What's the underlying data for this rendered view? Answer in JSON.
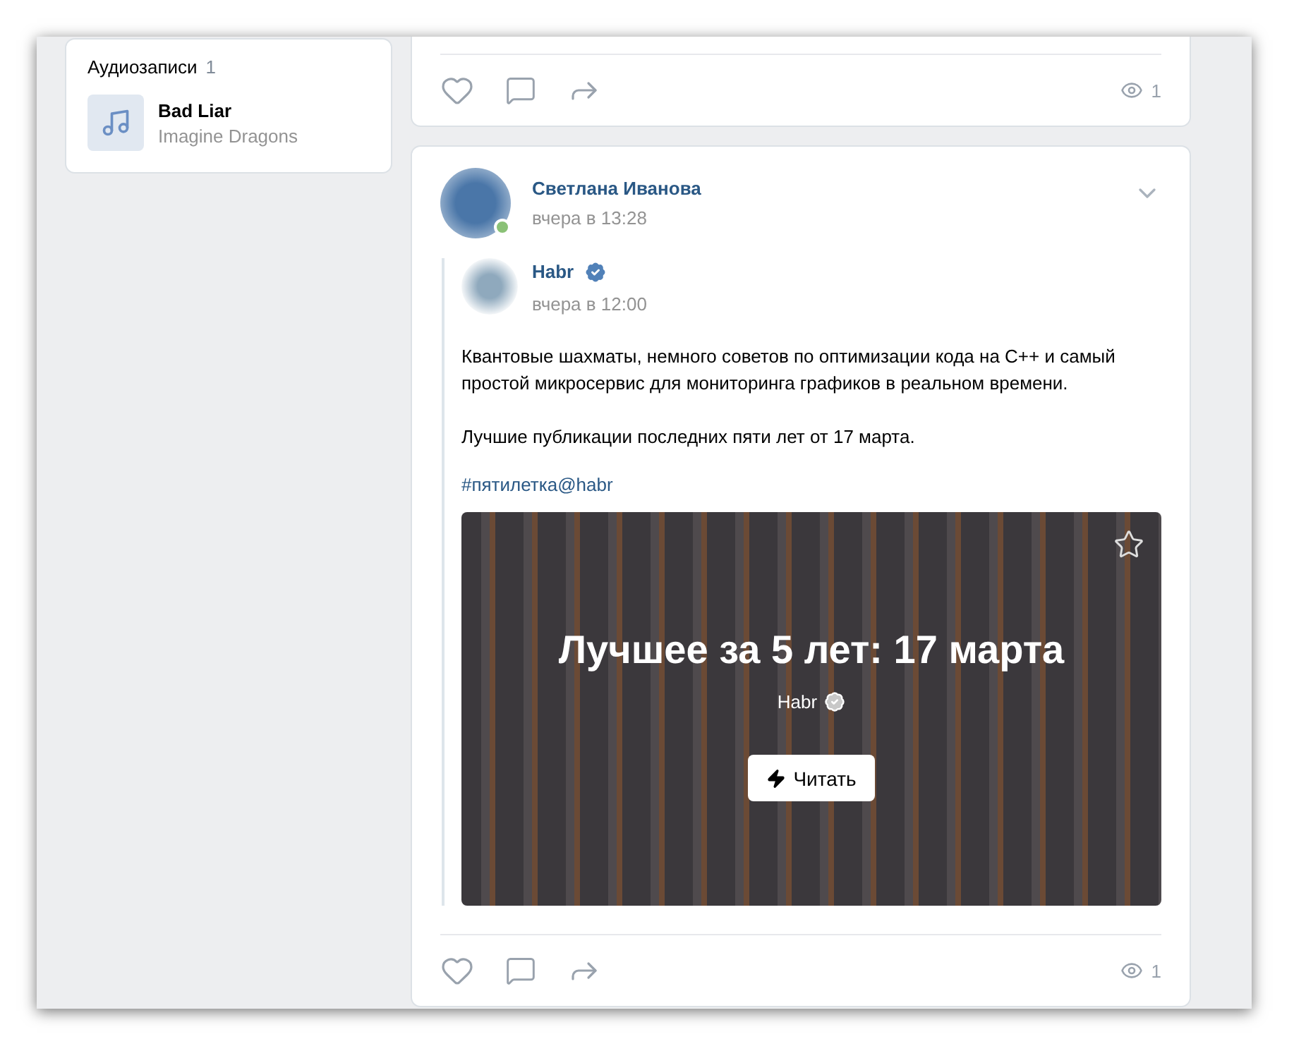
{
  "audio": {
    "title": "Аудиозаписи",
    "count": "1",
    "tracks": [
      {
        "title": "Bad Liar",
        "artist": "Imagine Dragons"
      }
    ]
  },
  "previous_post": {
    "views": "1"
  },
  "post": {
    "author": "Светлана Иванова",
    "online": true,
    "time": "вчера в 13:28",
    "repost": {
      "author": "Habr",
      "verified": true,
      "time": "вчера в 12:00",
      "paragraphs": [
        "Квантовые шахматы, немного советов по оптимизации кода на C++ и самый простой микросервис для мониторинга графиков в реальном времени.",
        "Лучшие публикации последних пяти лет от 17 марта.",
        "#пятилетка@habr"
      ],
      "article": {
        "title": "Лучшее за 5 лет: 17 марта",
        "source": "Habr",
        "verified": true,
        "button": "Читать"
      }
    },
    "views": "1"
  }
}
